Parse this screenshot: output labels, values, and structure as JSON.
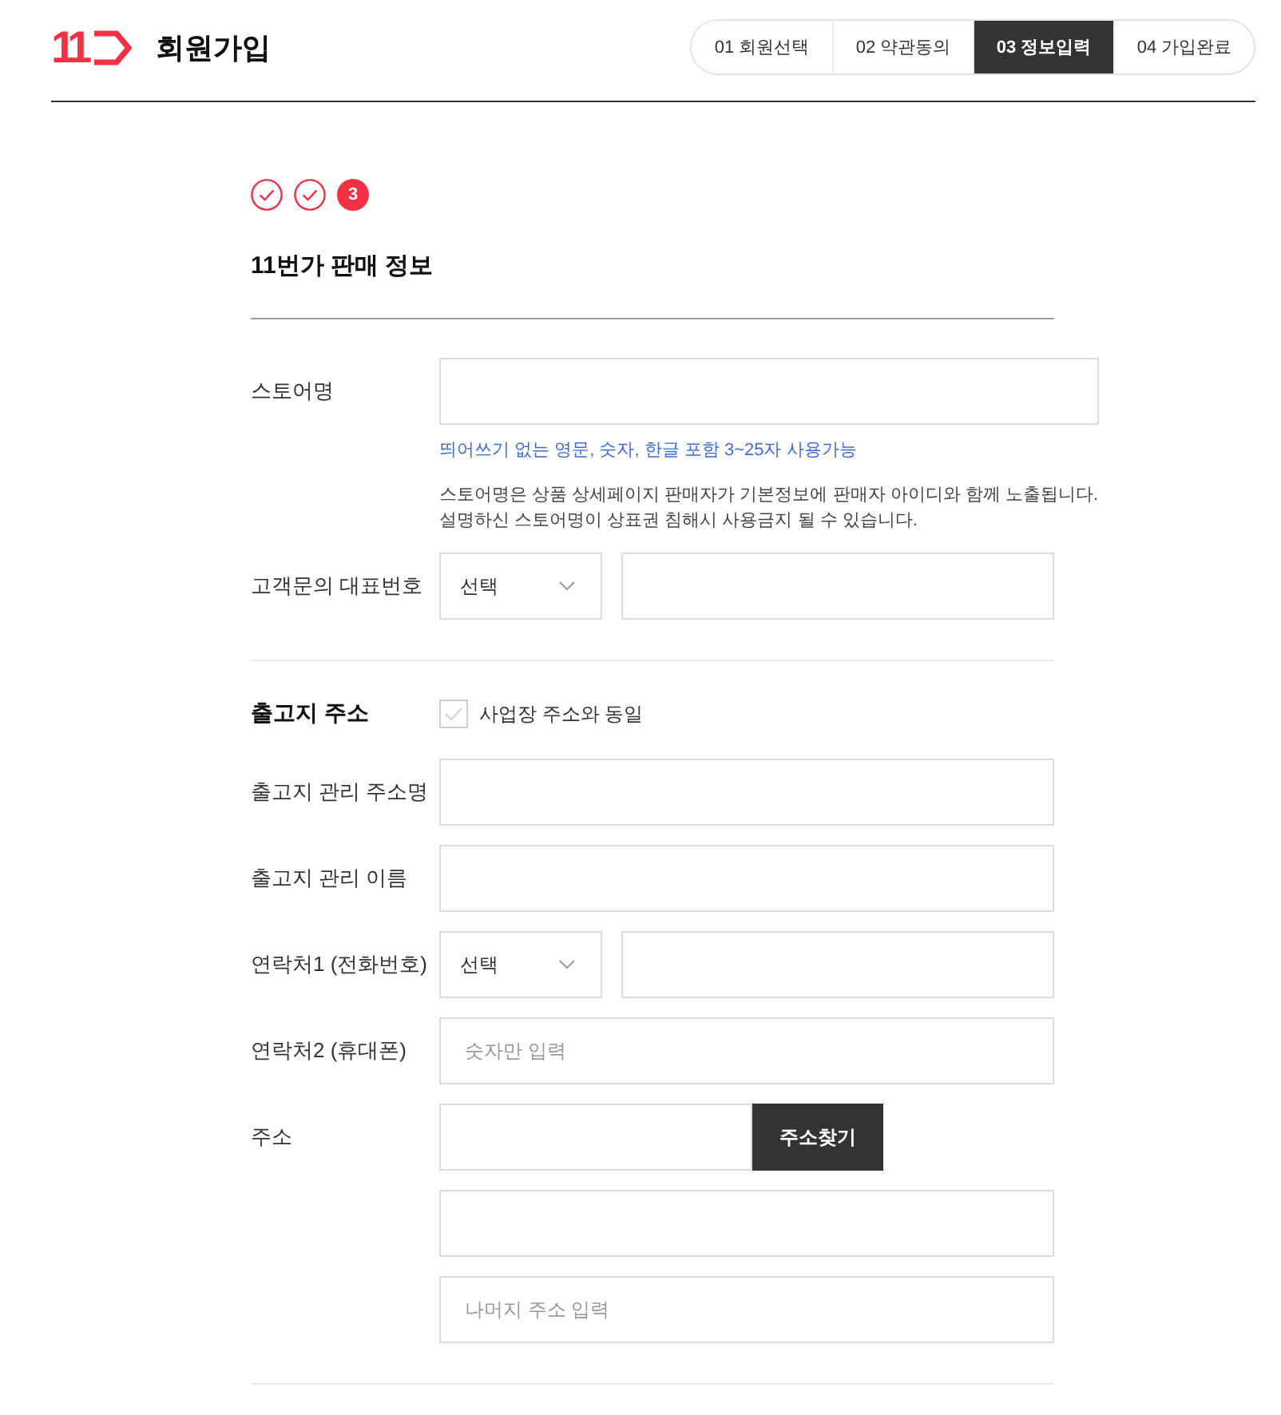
{
  "header": {
    "logo": "11",
    "title": "회원가입",
    "steps": [
      {
        "label": "01 회원선택",
        "selected": false
      },
      {
        "label": "02 약관동의",
        "selected": false
      },
      {
        "label": "03 정보입력",
        "selected": true
      },
      {
        "label": "04 가입완료",
        "selected": false
      }
    ]
  },
  "progress": [
    {
      "kind": "done"
    },
    {
      "kind": "done"
    },
    {
      "kind": "current",
      "label": "3"
    }
  ],
  "form": {
    "title": "11번가 판매 정보",
    "groups": [
      {
        "rows": [
          {
            "kind": "text",
            "label": "스토어명",
            "hint": "띄어쓰기 없는 영문, 숫자, 한글 포함 3~25자 사용가능",
            "notes": [
              "스토어명은 상품 상세페이지 판매자가 기본정보에 판매자 아이디와 함께 노출됩니다.",
              "설명하신 스토어명이 상표권 침해시 사용금지 될 수 있습니다."
            ]
          },
          {
            "kind": "phone",
            "label": "고객문의 대표번호",
            "select": "선택"
          }
        ]
      },
      {
        "heading": "출고지 주소",
        "checkbox": {
          "label": "사업장 주소와 동일",
          "checked": false
        },
        "rows": [
          {
            "kind": "text",
            "label": "출고지 관리 주소명"
          },
          {
            "kind": "text",
            "label": "출고지 관리 이름"
          },
          {
            "kind": "phone",
            "label": "연락처1 (전화번호)",
            "select": "선택"
          },
          {
            "kind": "text",
            "label": "연락처2 (휴대폰)",
            "placeholder": "숫자만 입력"
          },
          {
            "kind": "address",
            "label": "주소",
            "button": "주소찾기",
            "detail_placeholder": "나머지 주소 입력"
          }
        ]
      }
    ]
  }
}
